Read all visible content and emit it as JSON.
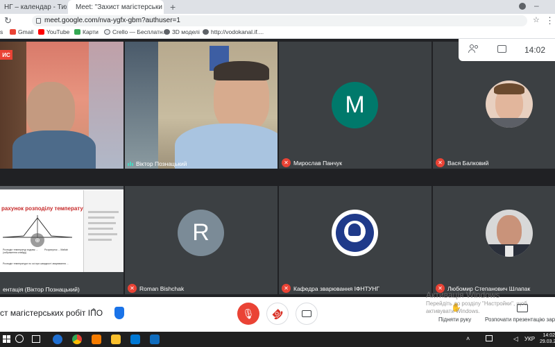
{
  "browser": {
    "tabs": [
      {
        "label": "НГ – календар - Тиждень",
        "active": false
      },
      {
        "label": "Meet: \"Захист магістерськи",
        "active": true
      }
    ],
    "new_tab_glyph": "+",
    "url": "meet.google.com/nva-ygfx-gbm?authuser=1",
    "bookmarks": [
      "s",
      "Gmail",
      "YouTube",
      "Карти",
      "Crello — Бесплатн...",
      "3D моделі",
      "http://vodokanal.if...."
    ]
  },
  "meet": {
    "clock": "14:02",
    "top_edge_text": "Б",
    "tiles": [
      {
        "name": "",
        "badge": "ИС",
        "muted": false
      },
      {
        "name": "Віктор Познацький",
        "muted": false,
        "speaking": true
      },
      {
        "name": "Мирослав Панчук",
        "avatar_letter": "M",
        "avatar_color": "#00796b",
        "muted": true
      },
      {
        "name": "Вася Балковий",
        "muted": true
      },
      {
        "name": "ентація (Віктор Познацький)",
        "muted": false
      },
      {
        "name": "Roman Bishchak",
        "avatar_letter": "R",
        "avatar_color": "#7b8b97",
        "muted": true
      },
      {
        "name": "Кафедра зварювання ІФНТУНГ",
        "muted": true
      },
      {
        "name": "Любомир Степанович Шлапак",
        "muted": true
      }
    ],
    "slide": {
      "title": "рахунок розподілу температур",
      "left_text": "Розподіл температур вздовж ... (зображення слайду)",
      "right_text": "Розрахунок ... Matlab",
      "bottom_text": "Розподіл температури по осі при швидкості зварювання ..."
    },
    "meeting_title": "ст магістерських робіт ІПО",
    "raise_hand_label": "Підняти руку",
    "present_label": "Розпочати презентацію зара",
    "watermark_title": "Активація Windows",
    "watermark_text": "Перейдіть до розділу \"Настройки\", щоб активувати Windows."
  },
  "taskbar": {
    "lang": "УКР",
    "time": "14:02",
    "date": "29.03.2"
  },
  "colors": {
    "mute_red": "#ea4335",
    "hangup_red": "#d93025",
    "stage_bg": "#202124",
    "tile_bg": "#3c4043"
  }
}
